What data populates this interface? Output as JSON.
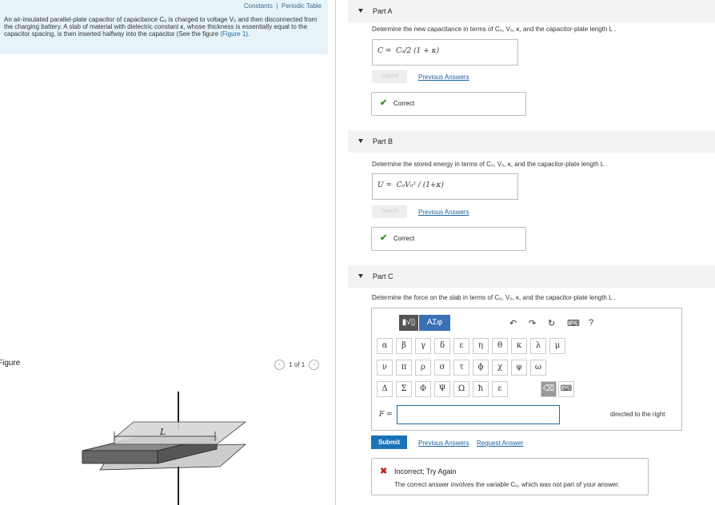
{
  "top_links": {
    "constants": "Constants",
    "separator": "|",
    "periodic_table": "Periodic Table"
  },
  "problem": {
    "text": "An air-insulated parallel-plate capacitor of capacitance C₀ is charged to voltage V₀ and then disconnected from the charging battery. A slab of material with dielectric constant κ, whose thickness is essentially equal to the capacitor spacing, is then inserted halfway into the capacitor (See the figure ",
    "figure_link": "(Figure 1)",
    "tail": "."
  },
  "figure": {
    "label": "Figure",
    "counter": "1 of 1",
    "prev": "‹",
    "next": "›",
    "dimension_label": "L"
  },
  "part_a": {
    "label": "Part A",
    "question": "Determine the new capacitance in terms of C₀, V₀, κ, and the capacitor-plate length L .",
    "answer_prefix": "C =",
    "answer": "C₀/2 (1 + κ)",
    "submit": "Submit",
    "previous_answers": "Previous Answers",
    "status": "Correct"
  },
  "part_b": {
    "label": "Part B",
    "question": "Determine the stored energy in terms of C₀, V₀, κ, and the capacitor-plate length L .",
    "answer_prefix": "U =",
    "answer": "C₀V₀² / (1+κ)",
    "submit": "Submit",
    "previous_answers": "Previous Answers",
    "status": "Correct"
  },
  "part_c": {
    "label": "Part C",
    "question": "Determine the force on the slab in terms of C₀, V₀, κ, and the capacitor-plate length L .",
    "toolbar": {
      "templates": "▮√▯",
      "symbols": "ΑΣφ",
      "undo": "↶",
      "redo": "↷",
      "reset": "↻",
      "keyboard": "⌨",
      "help": "?"
    },
    "greek_row1": [
      "α",
      "β",
      "γ",
      "δ",
      "ε",
      "η",
      "θ",
      "κ",
      "λ",
      "μ"
    ],
    "greek_row2": [
      "ν",
      "π",
      "ρ",
      "σ",
      "τ",
      "ϕ",
      "χ",
      "ψ",
      "ω"
    ],
    "greek_row3": [
      "Δ",
      "Σ",
      "Φ",
      "Ψ",
      "Ω",
      "ħ",
      "ε"
    ],
    "delete_key": "⌫",
    "keyboard_key": "⌨",
    "answer_prefix": "F =",
    "answer_value": "",
    "direction": "directed to the right",
    "submit": "Submit",
    "previous_answers": "Previous Answers",
    "request_answer": "Request Answer",
    "status": "Incorrect; Try Again",
    "feedback": "The correct answer involves the variable C₀, which was not part of your answer."
  }
}
